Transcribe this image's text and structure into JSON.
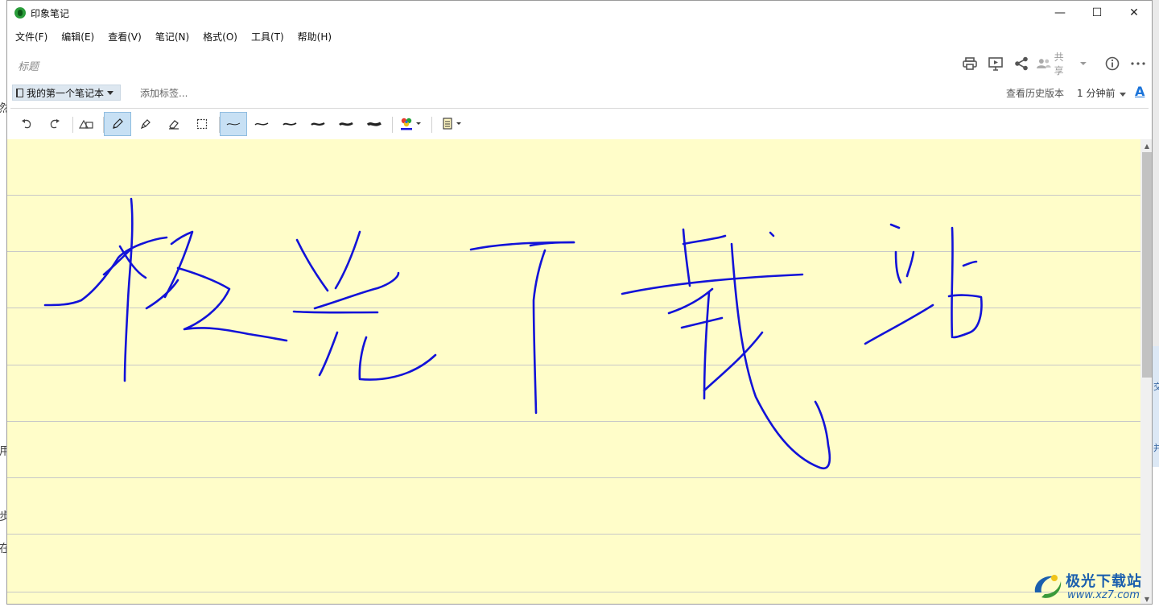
{
  "app": {
    "title": "印象笔记"
  },
  "window_controls": {
    "minimize": "—",
    "maximize": "☐",
    "close": "✕"
  },
  "menu": [
    {
      "label": "文件(F)"
    },
    {
      "label": "编辑(E)"
    },
    {
      "label": "查看(V)"
    },
    {
      "label": "笔记(N)"
    },
    {
      "label": "格式(O)"
    },
    {
      "label": "工具(T)"
    },
    {
      "label": "帮助(H)"
    }
  ],
  "note": {
    "title_placeholder": "标题",
    "notebook": "我的第一个笔记本",
    "add_tags": "添加标签...",
    "history": "查看历史版本",
    "time_ago": "1 分钟前",
    "font_button": "A"
  },
  "top_tools": {
    "share_label": "共享",
    "icons": [
      "print-icon",
      "present-icon",
      "share-icon",
      "people-icon",
      "info-icon",
      "more-icon"
    ]
  },
  "ink_toolbar": {
    "tools": [
      "undo-icon",
      "redo-icon",
      "shapes-icon",
      "pen-icon",
      "highlighter-icon",
      "eraser-icon",
      "lasso-select-icon"
    ],
    "active_tool": "pen-icon",
    "stroke_widths": 6,
    "active_width_index": 0,
    "pen_color": "#1a1adb"
  },
  "ink": {
    "text": "极光下载站",
    "color": "#1212d8"
  },
  "background": {
    "left_glyphs": [
      "然",
      "用",
      "步",
      "在"
    ],
    "right_glyphs": [
      "交",
      "并"
    ]
  },
  "watermark": {
    "name": "极光下载站",
    "url": "www.xz7.com"
  },
  "colors": {
    "canvas": "#fffdc9",
    "accent": "#1a73d9"
  }
}
